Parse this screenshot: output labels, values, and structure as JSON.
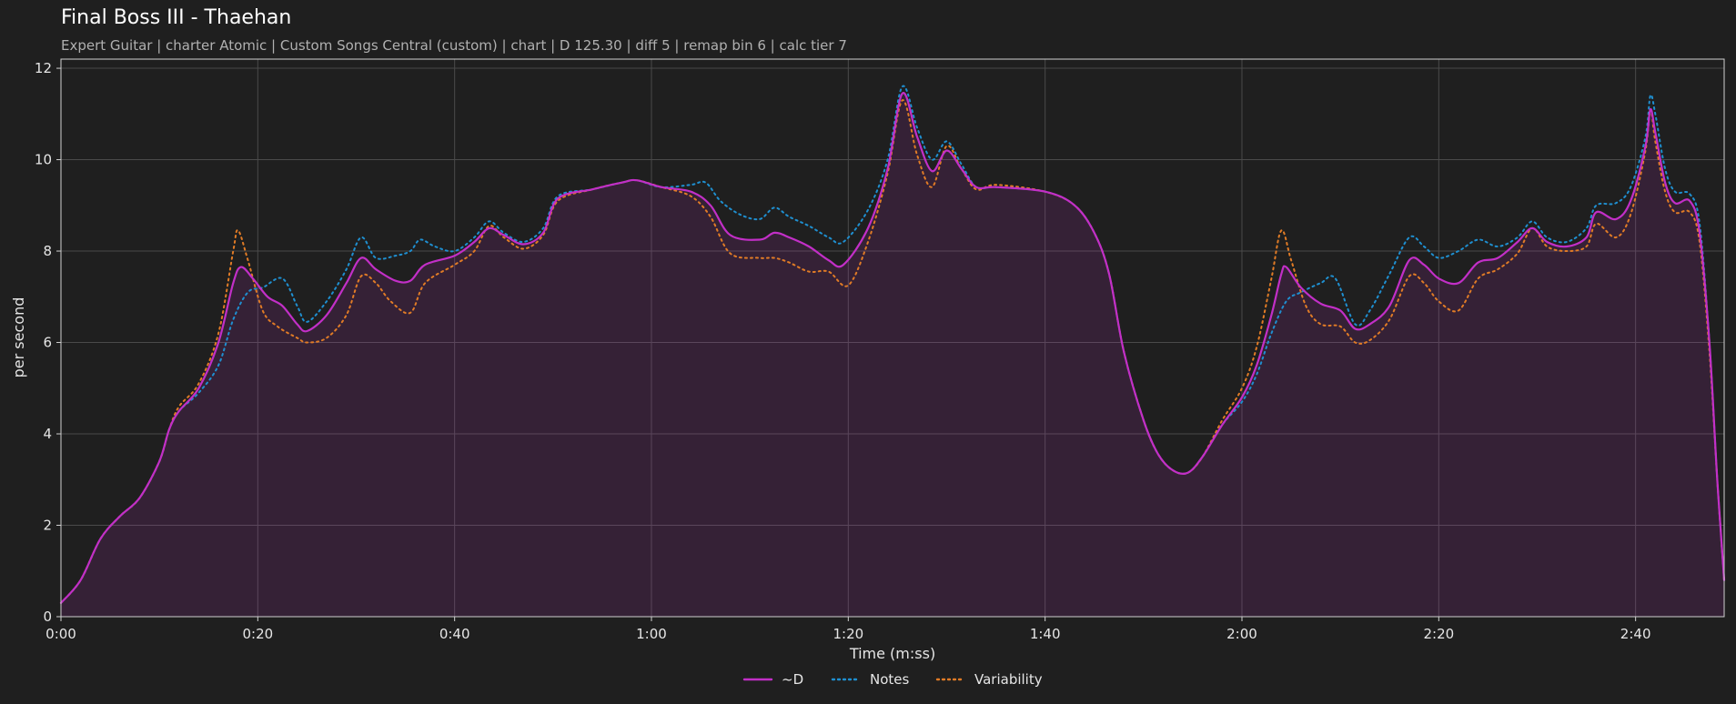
{
  "header": {
    "title": "Final Boss III - Thaehan",
    "subtitle": "Expert Guitar  |  charter Atomic  |  Custom Songs Central (custom)  |  chart  |  D 125.30  |  diff 5  |  remap bin 6  |  calc tier 7"
  },
  "chart_data": {
    "type": "line",
    "xlabel": "Time (m:ss)",
    "ylabel": "per second",
    "xlim": [
      0,
      169
    ],
    "ylim": [
      0,
      12.2
    ],
    "x_ticks": [
      0,
      20,
      40,
      60,
      80,
      100,
      120,
      140,
      160
    ],
    "x_tick_labels": [
      "0:00",
      "0:20",
      "0:40",
      "1:00",
      "1:20",
      "1:40",
      "2:00",
      "2:20",
      "2:40"
    ],
    "y_ticks": [
      0,
      2,
      4,
      6,
      8,
      10,
      12
    ],
    "y_tick_labels": [
      "0",
      "2",
      "4",
      "6",
      "8",
      "10",
      "12"
    ],
    "grid": true,
    "legend_position": "bottom-center",
    "series": [
      {
        "name": "~D",
        "color": "#c22fc7",
        "style": "solid",
        "fill": true,
        "points": [
          [
            0,
            0.3
          ],
          [
            2,
            0.8
          ],
          [
            4,
            1.7
          ],
          [
            6,
            2.2
          ],
          [
            8,
            2.6
          ],
          [
            10,
            3.4
          ],
          [
            11,
            4.1
          ],
          [
            12,
            4.5
          ],
          [
            14,
            5.0
          ],
          [
            16,
            6.0
          ],
          [
            17.5,
            7.3
          ],
          [
            18.3,
            7.65
          ],
          [
            19.5,
            7.4
          ],
          [
            21,
            7.0
          ],
          [
            22.5,
            6.8
          ],
          [
            24,
            6.4
          ],
          [
            25,
            6.25
          ],
          [
            27,
            6.6
          ],
          [
            29,
            7.3
          ],
          [
            30.5,
            7.85
          ],
          [
            32,
            7.6
          ],
          [
            34,
            7.35
          ],
          [
            35.5,
            7.35
          ],
          [
            37,
            7.7
          ],
          [
            40,
            7.9
          ],
          [
            42,
            8.2
          ],
          [
            43.5,
            8.5
          ],
          [
            45,
            8.35
          ],
          [
            47,
            8.15
          ],
          [
            49,
            8.4
          ],
          [
            50.5,
            9.15
          ],
          [
            54,
            9.35
          ],
          [
            57,
            9.5
          ],
          [
            58.5,
            9.55
          ],
          [
            61,
            9.4
          ],
          [
            64,
            9.3
          ],
          [
            66,
            9.0
          ],
          [
            68,
            8.35
          ],
          [
            71,
            8.25
          ],
          [
            72.5,
            8.4
          ],
          [
            74,
            8.3
          ],
          [
            76,
            8.1
          ],
          [
            78,
            7.8
          ],
          [
            79.5,
            7.7
          ],
          [
            82,
            8.5
          ],
          [
            84,
            9.8
          ],
          [
            85.5,
            11.45
          ],
          [
            87,
            10.5
          ],
          [
            88.5,
            9.75
          ],
          [
            90,
            10.2
          ],
          [
            91.5,
            9.8
          ],
          [
            93,
            9.4
          ],
          [
            95,
            9.4
          ],
          [
            100,
            9.3
          ],
          [
            103,
            9.0
          ],
          [
            105,
            8.4
          ],
          [
            106.5,
            7.5
          ],
          [
            108,
            5.8
          ],
          [
            110,
            4.3
          ],
          [
            111.5,
            3.55
          ],
          [
            113,
            3.2
          ],
          [
            114.5,
            3.15
          ],
          [
            116,
            3.5
          ],
          [
            118,
            4.2
          ],
          [
            120,
            4.8
          ],
          [
            121.5,
            5.5
          ],
          [
            123,
            6.6
          ],
          [
            124,
            7.5
          ],
          [
            124.5,
            7.65
          ],
          [
            126,
            7.2
          ],
          [
            128,
            6.85
          ],
          [
            130,
            6.7
          ],
          [
            131.5,
            6.3
          ],
          [
            133,
            6.4
          ],
          [
            135,
            6.8
          ],
          [
            137,
            7.8
          ],
          [
            138.5,
            7.7
          ],
          [
            140,
            7.4
          ],
          [
            142,
            7.3
          ],
          [
            144,
            7.75
          ],
          [
            146,
            7.85
          ],
          [
            148,
            8.2
          ],
          [
            149.5,
            8.5
          ],
          [
            151,
            8.2
          ],
          [
            153,
            8.1
          ],
          [
            155,
            8.3
          ],
          [
            156,
            8.85
          ],
          [
            158,
            8.7
          ],
          [
            159.5,
            9.1
          ],
          [
            161,
            10.3
          ],
          [
            161.5,
            11.1
          ],
          [
            162,
            10.6
          ],
          [
            163,
            9.5
          ],
          [
            164,
            9.05
          ],
          [
            165.5,
            9.1
          ],
          [
            166.5,
            8.4
          ],
          [
            167.5,
            6.0
          ],
          [
            168.3,
            3.0
          ],
          [
            169,
            0.8
          ]
        ]
      },
      {
        "name": "Notes",
        "color": "#1f8fd0",
        "style": "dotted",
        "fill": false,
        "points": [
          [
            0,
            0.3
          ],
          [
            2,
            0.8
          ],
          [
            4,
            1.7
          ],
          [
            6,
            2.2
          ],
          [
            8,
            2.6
          ],
          [
            10,
            3.4
          ],
          [
            11,
            4.1
          ],
          [
            12,
            4.5
          ],
          [
            14,
            4.9
          ],
          [
            16,
            5.5
          ],
          [
            17.5,
            6.5
          ],
          [
            19,
            7.1
          ],
          [
            20.5,
            7.2
          ],
          [
            22.5,
            7.4
          ],
          [
            24,
            6.8
          ],
          [
            25,
            6.45
          ],
          [
            27,
            6.9
          ],
          [
            29,
            7.6
          ],
          [
            30.5,
            8.3
          ],
          [
            32,
            7.85
          ],
          [
            34,
            7.9
          ],
          [
            35.5,
            8.0
          ],
          [
            36.5,
            8.25
          ],
          [
            38,
            8.1
          ],
          [
            40,
            8.0
          ],
          [
            42,
            8.3
          ],
          [
            43.5,
            8.65
          ],
          [
            45,
            8.4
          ],
          [
            47,
            8.2
          ],
          [
            49,
            8.5
          ],
          [
            50.5,
            9.2
          ],
          [
            54,
            9.35
          ],
          [
            57,
            9.5
          ],
          [
            58.5,
            9.55
          ],
          [
            61,
            9.4
          ],
          [
            64,
            9.45
          ],
          [
            65.5,
            9.5
          ],
          [
            67,
            9.1
          ],
          [
            69,
            8.8
          ],
          [
            71,
            8.7
          ],
          [
            72.5,
            8.95
          ],
          [
            74,
            8.75
          ],
          [
            76,
            8.55
          ],
          [
            78,
            8.3
          ],
          [
            79.5,
            8.2
          ],
          [
            82,
            8.9
          ],
          [
            84,
            10.0
          ],
          [
            85.5,
            11.6
          ],
          [
            87,
            10.7
          ],
          [
            88.5,
            10.0
          ],
          [
            90,
            10.4
          ],
          [
            91.5,
            9.9
          ],
          [
            93,
            9.4
          ],
          [
            95,
            9.4
          ],
          [
            100,
            9.3
          ],
          [
            103,
            9.0
          ],
          [
            105,
            8.4
          ],
          [
            106.5,
            7.5
          ],
          [
            108,
            5.8
          ],
          [
            110,
            4.3
          ],
          [
            111.5,
            3.55
          ],
          [
            113,
            3.2
          ],
          [
            114.5,
            3.15
          ],
          [
            116,
            3.5
          ],
          [
            118,
            4.2
          ],
          [
            120,
            4.7
          ],
          [
            121.5,
            5.3
          ],
          [
            123,
            6.2
          ],
          [
            124.5,
            6.9
          ],
          [
            126,
            7.1
          ],
          [
            128,
            7.3
          ],
          [
            129.5,
            7.4
          ],
          [
            131.5,
            6.4
          ],
          [
            133,
            6.7
          ],
          [
            135,
            7.5
          ],
          [
            137,
            8.3
          ],
          [
            138.5,
            8.1
          ],
          [
            140,
            7.85
          ],
          [
            142,
            8.0
          ],
          [
            144,
            8.25
          ],
          [
            146,
            8.1
          ],
          [
            148,
            8.3
          ],
          [
            149.5,
            8.65
          ],
          [
            151,
            8.3
          ],
          [
            153,
            8.2
          ],
          [
            155,
            8.5
          ],
          [
            156,
            9.0
          ],
          [
            158,
            9.05
          ],
          [
            159.5,
            9.4
          ],
          [
            161,
            10.5
          ],
          [
            161.5,
            11.4
          ],
          [
            162,
            11.0
          ],
          [
            163,
            9.8
          ],
          [
            164,
            9.3
          ],
          [
            165.5,
            9.25
          ],
          [
            166.5,
            8.6
          ],
          [
            167.5,
            6.0
          ],
          [
            168.3,
            3.0
          ],
          [
            169,
            0.8
          ]
        ]
      },
      {
        "name": "Variability",
        "color": "#e07b26",
        "style": "dotted",
        "fill": false,
        "points": [
          [
            0,
            0.3
          ],
          [
            2,
            0.8
          ],
          [
            4,
            1.7
          ],
          [
            6,
            2.2
          ],
          [
            8,
            2.6
          ],
          [
            10,
            3.4
          ],
          [
            11,
            4.1
          ],
          [
            12,
            4.6
          ],
          [
            14,
            5.1
          ],
          [
            16,
            6.2
          ],
          [
            17.5,
            8.0
          ],
          [
            18,
            8.45
          ],
          [
            19,
            7.8
          ],
          [
            20.5,
            6.7
          ],
          [
            22,
            6.35
          ],
          [
            24,
            6.1
          ],
          [
            25,
            6.0
          ],
          [
            27,
            6.1
          ],
          [
            29,
            6.6
          ],
          [
            30.5,
            7.45
          ],
          [
            32,
            7.3
          ],
          [
            33.5,
            6.9
          ],
          [
            35.5,
            6.65
          ],
          [
            37,
            7.3
          ],
          [
            40,
            7.7
          ],
          [
            42,
            8.0
          ],
          [
            43.5,
            8.55
          ],
          [
            45,
            8.3
          ],
          [
            47,
            8.05
          ],
          [
            49,
            8.35
          ],
          [
            50.5,
            9.1
          ],
          [
            54,
            9.35
          ],
          [
            57,
            9.5
          ],
          [
            58.5,
            9.55
          ],
          [
            61,
            9.4
          ],
          [
            64,
            9.2
          ],
          [
            66,
            8.75
          ],
          [
            68,
            7.95
          ],
          [
            71,
            7.85
          ],
          [
            72.5,
            7.85
          ],
          [
            74,
            7.75
          ],
          [
            76,
            7.55
          ],
          [
            78,
            7.55
          ],
          [
            80,
            7.25
          ],
          [
            82,
            8.2
          ],
          [
            84,
            9.7
          ],
          [
            85.5,
            11.3
          ],
          [
            87,
            10.1
          ],
          [
            88.5,
            9.4
          ],
          [
            90,
            10.3
          ],
          [
            91.5,
            9.8
          ],
          [
            93,
            9.35
          ],
          [
            95,
            9.45
          ],
          [
            100,
            9.3
          ],
          [
            103,
            9.0
          ],
          [
            105,
            8.4
          ],
          [
            106.5,
            7.5
          ],
          [
            108,
            5.8
          ],
          [
            110,
            4.3
          ],
          [
            111.5,
            3.55
          ],
          [
            113,
            3.2
          ],
          [
            114.5,
            3.15
          ],
          [
            116,
            3.5
          ],
          [
            118,
            4.3
          ],
          [
            120,
            5.0
          ],
          [
            121.5,
            5.9
          ],
          [
            123,
            7.4
          ],
          [
            124,
            8.45
          ],
          [
            125,
            7.8
          ],
          [
            126.5,
            6.8
          ],
          [
            128,
            6.4
          ],
          [
            130,
            6.35
          ],
          [
            131.5,
            6.0
          ],
          [
            133,
            6.05
          ],
          [
            135,
            6.5
          ],
          [
            137,
            7.45
          ],
          [
            138.5,
            7.3
          ],
          [
            140,
            6.9
          ],
          [
            142,
            6.7
          ],
          [
            144,
            7.4
          ],
          [
            146,
            7.6
          ],
          [
            148,
            7.95
          ],
          [
            149.5,
            8.5
          ],
          [
            151,
            8.1
          ],
          [
            153,
            8.0
          ],
          [
            155,
            8.1
          ],
          [
            156,
            8.6
          ],
          [
            158,
            8.3
          ],
          [
            159.5,
            8.8
          ],
          [
            161,
            10.2
          ],
          [
            161.5,
            11.1
          ],
          [
            162,
            10.4
          ],
          [
            163,
            9.3
          ],
          [
            164,
            8.85
          ],
          [
            165.5,
            8.85
          ],
          [
            166.5,
            8.2
          ],
          [
            167.5,
            5.8
          ],
          [
            168.3,
            3.0
          ],
          [
            169,
            0.8
          ]
        ]
      }
    ]
  }
}
